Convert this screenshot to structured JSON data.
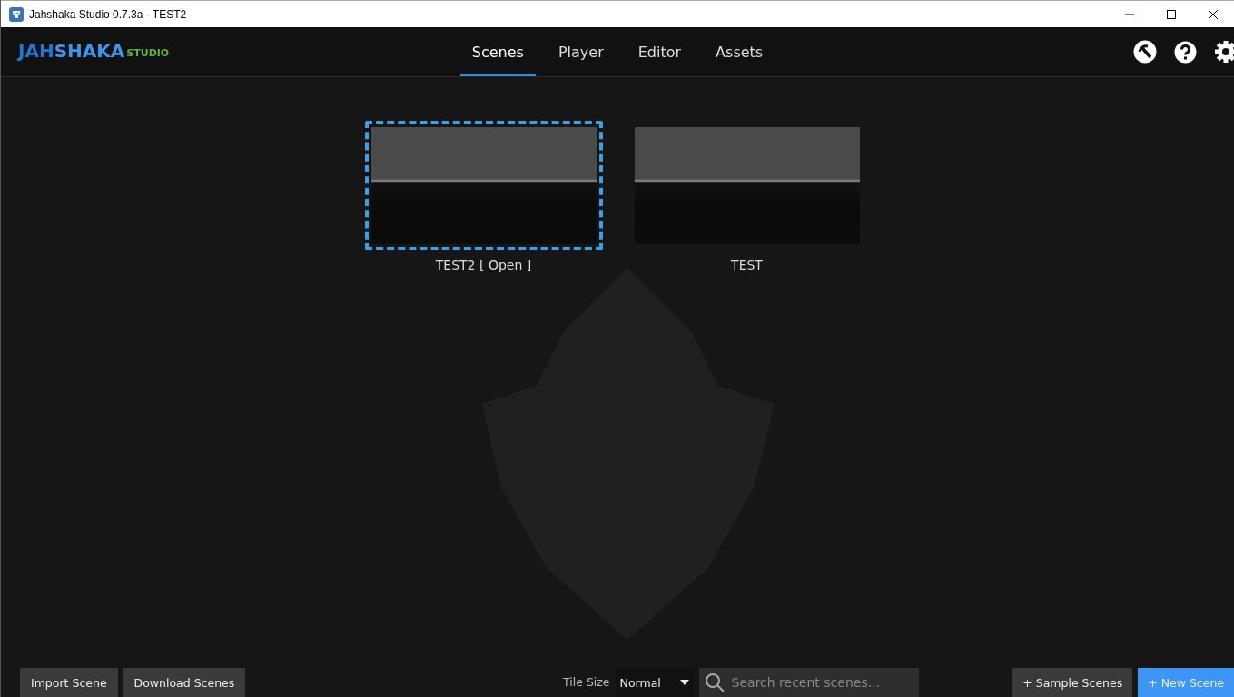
{
  "window": {
    "title": "Jahshaka Studio 0.7.3a - TEST2"
  },
  "logo": {
    "part_1": "JAH",
    "part_2": "SHAKA",
    "part_3": "STUDIO"
  },
  "tabs": [
    {
      "label": "Scenes",
      "selected": true
    },
    {
      "label": "Player",
      "selected": false
    },
    {
      "label": "Editor",
      "selected": false
    },
    {
      "label": "Assets",
      "selected": false
    }
  ],
  "scenes": [
    {
      "label": "TEST2 [ Open ]",
      "selected": true
    },
    {
      "label": "TEST",
      "selected": false
    }
  ],
  "footer": {
    "left_buttons": [
      "Import Scene",
      "Download Scenes"
    ],
    "tile_size_label": "Tile Size",
    "tile_size": "Normal",
    "search": {
      "placeholder": "Search recent scenes..."
    },
    "right_buttons": [
      {
        "label": "+ Sample Scenes",
        "kind": "secondary"
      },
      {
        "label": "+ New Scene",
        "kind": "primary"
      }
    ]
  }
}
